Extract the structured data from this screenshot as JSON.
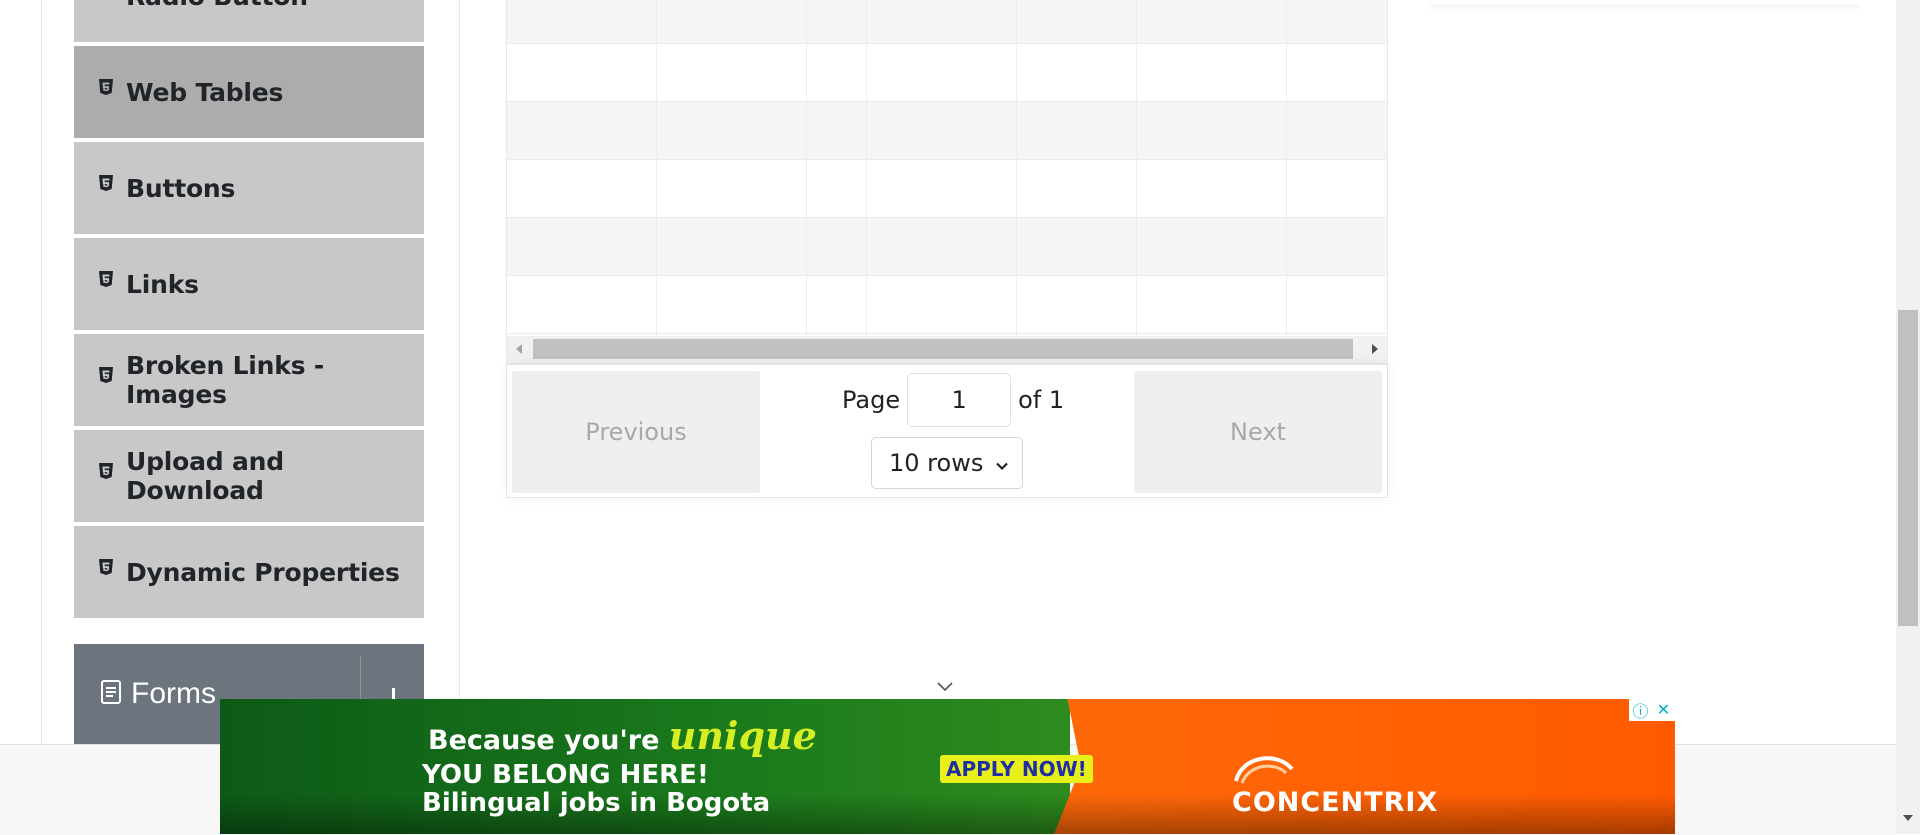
{
  "sidebar": {
    "items": [
      {
        "label": "Radio Button"
      },
      {
        "label": "Web Tables"
      },
      {
        "label": "Buttons"
      },
      {
        "label": "Links"
      },
      {
        "label": "Broken Links - Images"
      },
      {
        "label": "Upload and Download"
      },
      {
        "label": "Dynamic Properties"
      }
    ],
    "forms_label": "Forms"
  },
  "pagination": {
    "previous_label": "Previous",
    "next_label": "Next",
    "page_label": "Page",
    "page_value": "1",
    "of_label": "of 1",
    "rows_option": "10 rows"
  },
  "ad": {
    "line1_prefix": "Because you're",
    "line1_highlight": "unique",
    "line2": "YOU BELONG HERE!",
    "line3": "Bilingual jobs in Bogota",
    "cta": "APPLY NOW!",
    "brand": "CONCENTRIX",
    "info_icon": "ⓘ",
    "close_icon": "✕"
  },
  "colors": {
    "sidebar_item": "#c8c8c8",
    "sidebar_item_active": "#acacac",
    "forms_header": "#6c757d",
    "ad_green": "#1a7a1c",
    "ad_orange": "#ff5a00"
  }
}
